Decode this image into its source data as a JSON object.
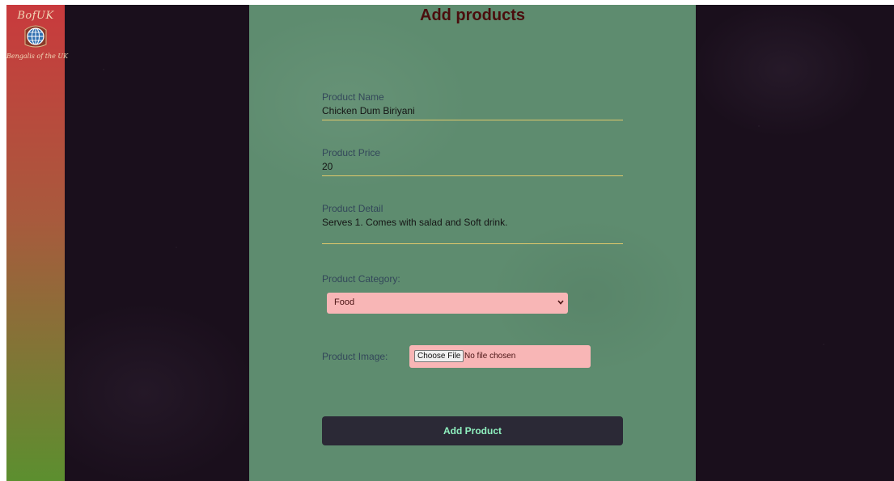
{
  "logo": {
    "top_text": "BofUK",
    "bottom_text": "Bengalis of the UK"
  },
  "form": {
    "title": "Add products",
    "name": {
      "label": "Product Name",
      "value": "Chicken Dum Biriyani"
    },
    "price": {
      "label": "Product Price",
      "value": "20"
    },
    "detail": {
      "label": "Product Detail",
      "value": "Serves 1. Comes with salad and Soft drink."
    },
    "category": {
      "label": "Product Category:",
      "selected": "Food"
    },
    "image": {
      "label": "Product Image:",
      "button_label": "Choose File",
      "status": "No file chosen"
    },
    "submit_label": "Add Product"
  },
  "colors": {
    "panel": "#5e8c6f",
    "title": "#4a0d0d",
    "input_underline": "#e0c96b",
    "pink_control": "#f8b6b6",
    "button_bg": "#2b2936",
    "button_text": "#8ff0bf",
    "sidebar_top": "#c93a3d",
    "sidebar_bottom": "#5c8f2f"
  },
  "icons": {
    "logo": "globe-icon",
    "select": "chevron-down-icon"
  }
}
